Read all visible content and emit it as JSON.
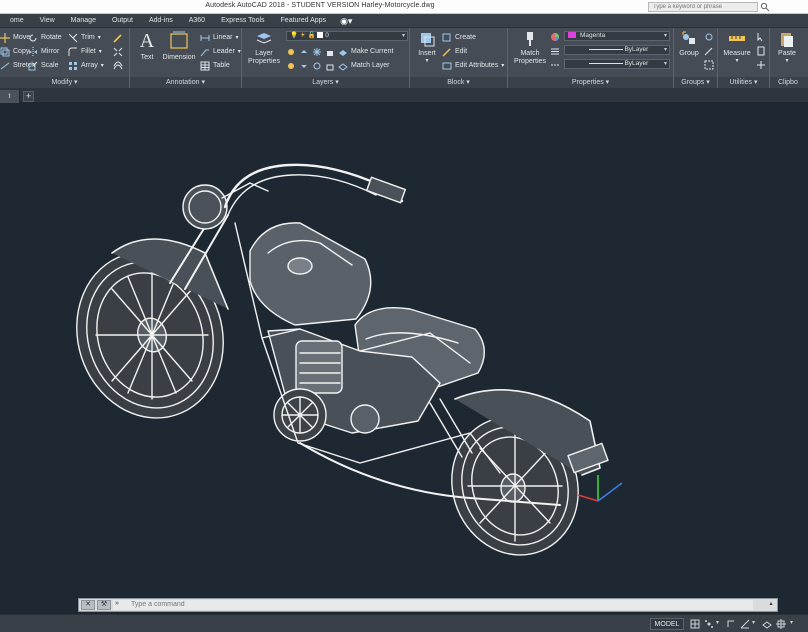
{
  "window": {
    "title": "Autodesk AutoCAD 2018 - STUDENT VERSION    Harley-Motorcycle.dwg",
    "search_placeholder": "Type a keyword or phrase"
  },
  "ribbon_tabs": [
    "ome",
    "View",
    "Manage",
    "Output",
    "Add-ins",
    "A360",
    "Express Tools",
    "Featured Apps"
  ],
  "ribbon": {
    "modify": {
      "label": "Modify",
      "col1": [
        "Move",
        "Copy",
        "Stretch"
      ],
      "col2": [
        "Rotate",
        "Mirror",
        "Scale"
      ],
      "col3": [
        "Trim",
        "Fillet",
        "Array"
      ]
    },
    "annotation": {
      "label": "Annotation",
      "text": "Text",
      "dimension": "Dimension",
      "rows": [
        "Linear",
        "Leader",
        "Table"
      ]
    },
    "layers": {
      "label": "Layers",
      "layer_properties": "Layer Properties",
      "current_layer": "0",
      "make_current": "Make Current",
      "match_layer": "Match Layer"
    },
    "block": {
      "label": "Block",
      "insert": "Insert",
      "rows": [
        "Create",
        "Edit",
        "Edit Attributes"
      ]
    },
    "properties": {
      "label": "Properties",
      "match_properties": "Match Properties",
      "color": "Magenta",
      "linetype": "ByLayer",
      "lineweight": "ByLayer"
    },
    "groups": {
      "label": "Groups",
      "group": "Group"
    },
    "utilities": {
      "label": "Utilities",
      "measure": "Measure"
    },
    "clipboard": {
      "label": "Clipbo",
      "paste": "Paste"
    }
  },
  "file_tabs": {
    "current": "t",
    "new_tab": "+"
  },
  "command_line": {
    "placeholder": "Type a command",
    "chevron": "»"
  },
  "status_bar": {
    "model": "MODEL"
  },
  "colors": {
    "background": "#1e2833",
    "ribbon": "#454c55",
    "magenta": "#e040e0",
    "drawing_line": "#f2f2f2"
  }
}
